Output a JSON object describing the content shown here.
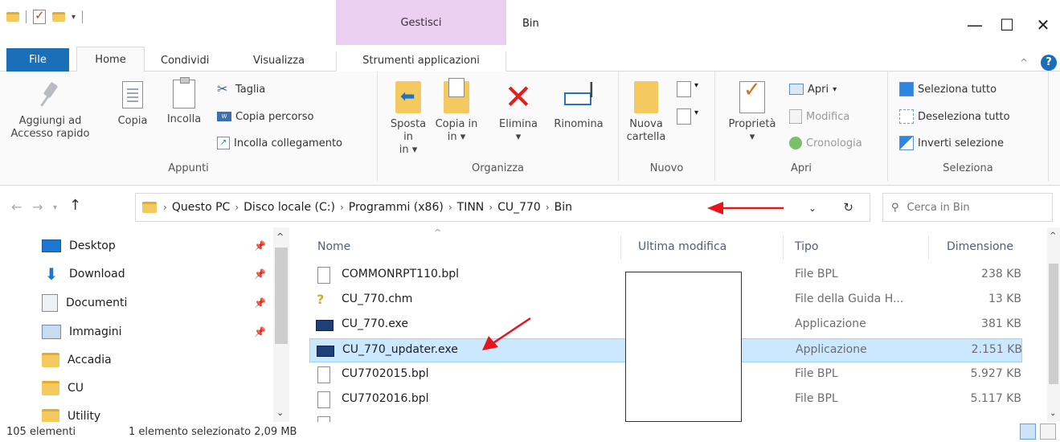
{
  "window": {
    "title": "Bin",
    "context_group": "Gestisci"
  },
  "tabs": {
    "file": "File",
    "home": "Home",
    "condividi": "Condividi",
    "visualizza": "Visualizza",
    "strumenti": "Strumenti applicazioni"
  },
  "ribbon": {
    "appunti": {
      "label": "Appunti",
      "pin": "Aggiungi ad Accesso rapido",
      "copy": "Copia",
      "paste": "Incolla",
      "cut": "Taglia",
      "copy_path": "Copia percorso",
      "paste_shortcut": "Incolla collegamento"
    },
    "organizza": {
      "label": "Organizza",
      "move_to": "Sposta in",
      "copy_to": "Copia in",
      "delete": "Elimina",
      "rename": "Rinomina"
    },
    "nuovo": {
      "label": "Nuovo",
      "new_folder": "Nuova cartella"
    },
    "apri": {
      "label": "Apri",
      "properties": "Proprietà",
      "open": "Apri",
      "edit": "Modifica",
      "history": "Cronologia"
    },
    "seleziona": {
      "label": "Seleziona",
      "select_all": "Seleziona tutto",
      "select_none": "Deseleziona tutto",
      "invert": "Inverti selezione"
    }
  },
  "address": {
    "crumbs": [
      "Questo PC",
      "Disco locale (C:)",
      "Programmi (x86)",
      "TINN",
      "CU_770",
      "Bin"
    ],
    "search_placeholder": "Cerca in Bin"
  },
  "nav_pane": {
    "items": [
      {
        "label": "Desktop",
        "icon": "desktop-icon",
        "pinned": true
      },
      {
        "label": "Download",
        "icon": "download-icon",
        "pinned": true
      },
      {
        "label": "Documenti",
        "icon": "documents-icon",
        "pinned": true
      },
      {
        "label": "Immagini",
        "icon": "pictures-icon",
        "pinned": true
      },
      {
        "label": "Accadia",
        "icon": "folder-icon",
        "pinned": false
      },
      {
        "label": "CU",
        "icon": "folder-icon",
        "pinned": false
      },
      {
        "label": "Utility",
        "icon": "folder-icon",
        "pinned": false
      }
    ]
  },
  "file_list": {
    "columns": {
      "name": "Nome",
      "modified": "Ultima modifica",
      "type": "Tipo",
      "size": "Dimensione"
    },
    "rows": [
      {
        "name": "COMMONRPT110.bpl",
        "type": "File BPL",
        "size": "238 KB",
        "icon": "file-icon"
      },
      {
        "name": "CU_770.chm",
        "type": "File della Guida H...",
        "size": "13 KB",
        "icon": "help-file-icon"
      },
      {
        "name": "CU_770.exe",
        "type": "Applicazione",
        "size": "381 KB",
        "icon": "exe-icon"
      },
      {
        "name": "CU_770_updater.exe",
        "type": "Applicazione",
        "size": "2.151 KB",
        "icon": "exe-icon",
        "selected": true
      },
      {
        "name": "CU7702015.bpl",
        "type": "File BPL",
        "size": "5.927 KB",
        "icon": "file-icon"
      },
      {
        "name": "CU7702016.bpl",
        "type": "File BPL",
        "size": "5.117 KB",
        "icon": "file-icon"
      }
    ]
  },
  "status": {
    "count": "105 elementi",
    "selection": "1 elemento selezionato  2,09 MB"
  },
  "colors": {
    "accent": "#1a6fb8",
    "context_tab": "#ecd0f2",
    "selection": "#cce8ff",
    "annotation": "#e8131b"
  }
}
